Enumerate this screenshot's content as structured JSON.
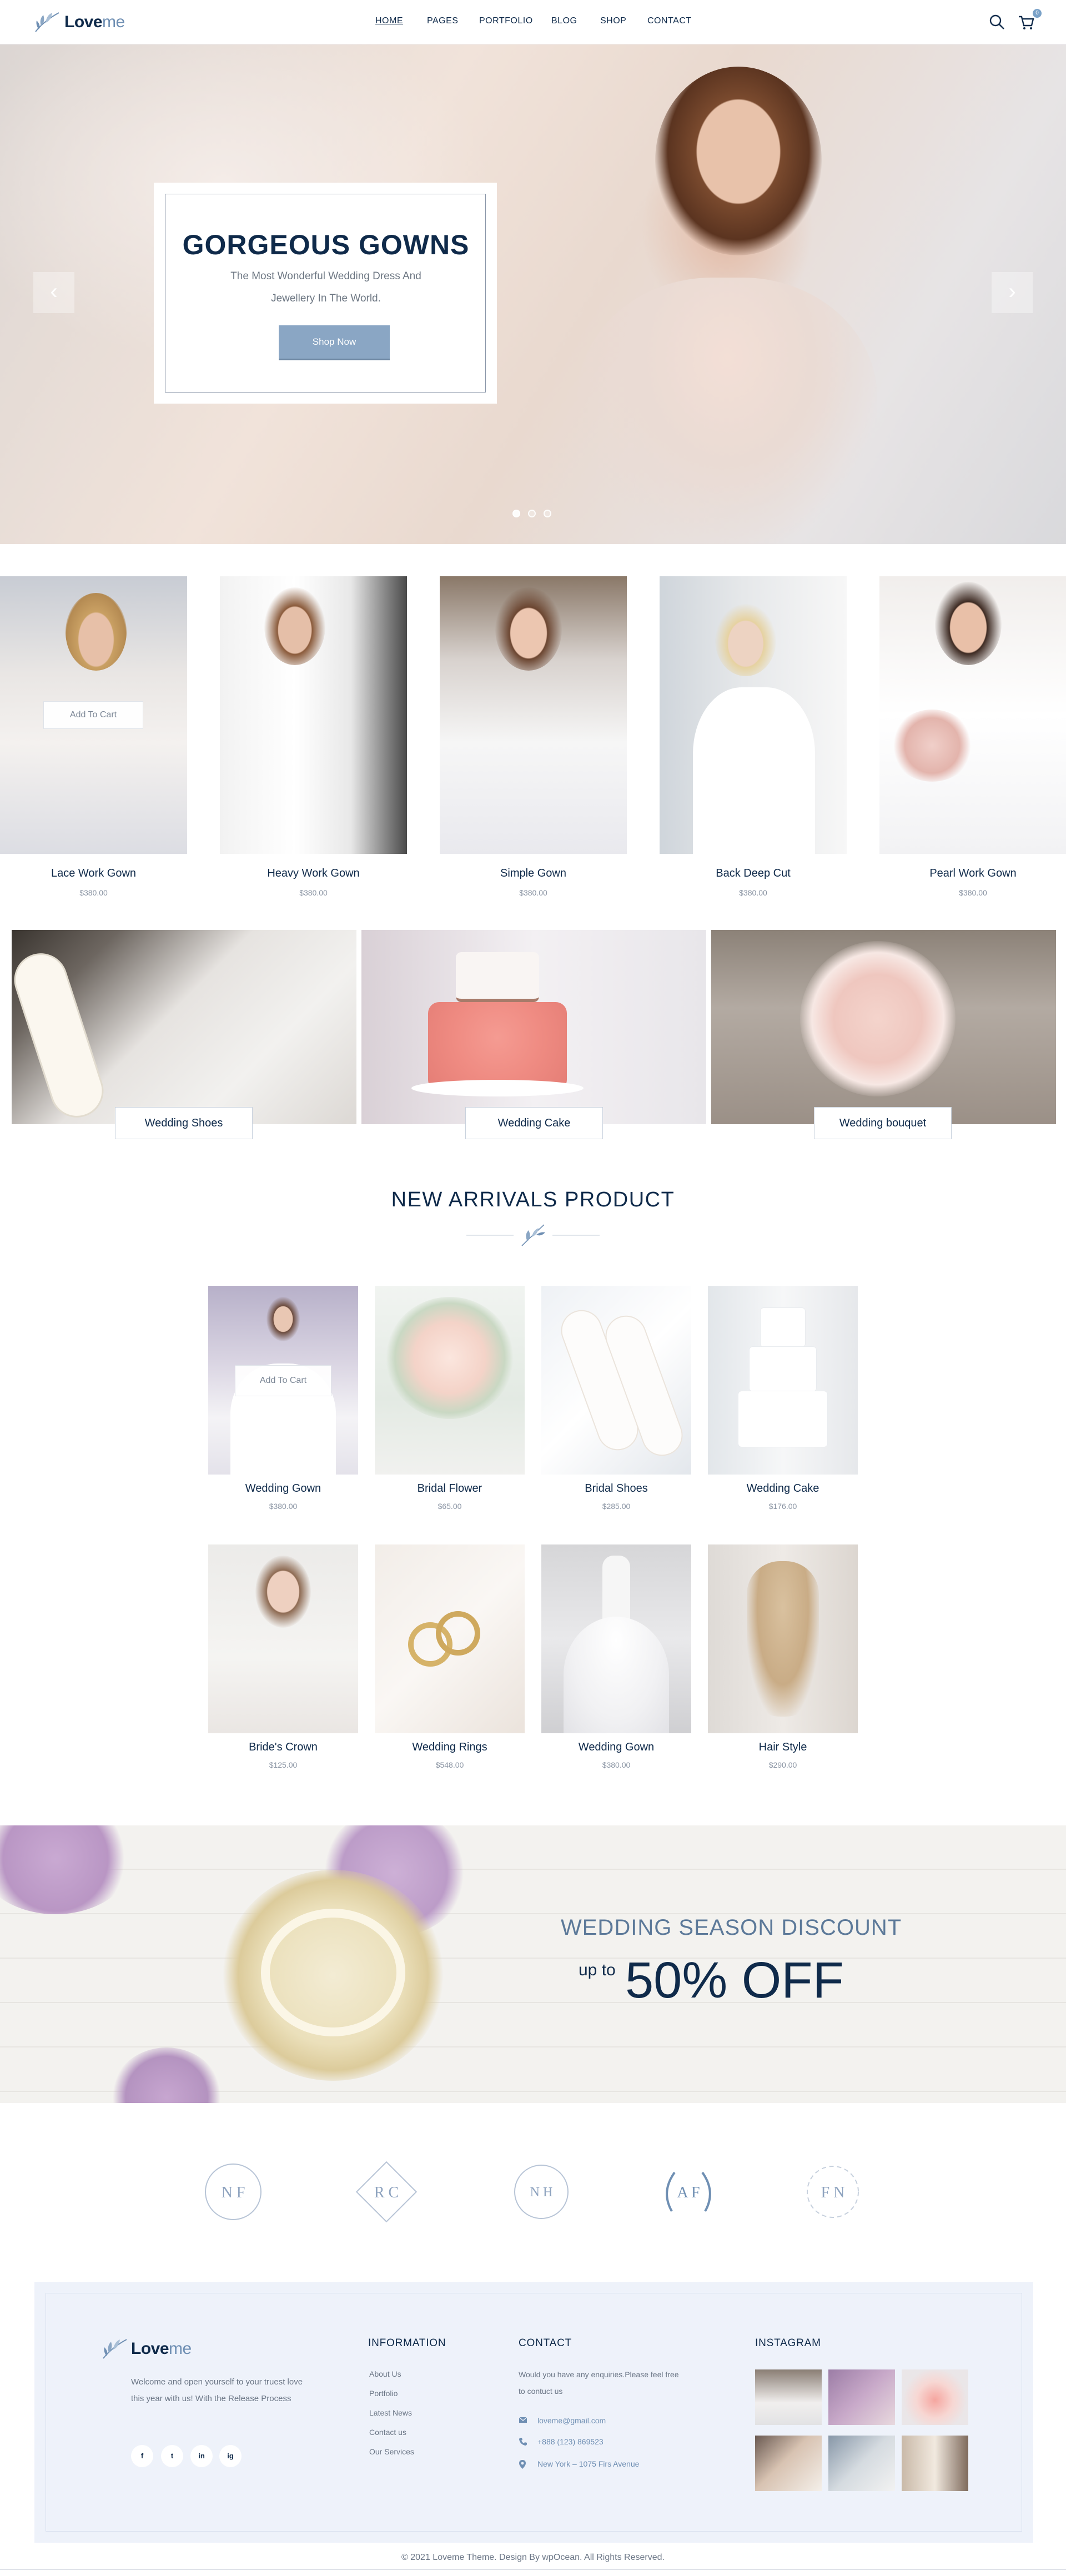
{
  "header": {
    "logo_main": "Love",
    "logo_accent": "me",
    "nav": [
      {
        "label": "HOME",
        "active": true
      },
      {
        "label": "PAGES",
        "active": false
      },
      {
        "label": "PORTFOLIO",
        "active": false
      },
      {
        "label": "BLOG",
        "active": false
      },
      {
        "label": "SHOP",
        "active": false
      },
      {
        "label": "CONTACT",
        "active": false
      }
    ],
    "cart_count": "0",
    "icons": [
      "search-icon",
      "cart-icon"
    ]
  },
  "hero": {
    "title": "GORGEOUS GOWNS",
    "subtitle": "The Most Wonderful Wedding Dress And Jewellery In The World.",
    "button": "Shop Now",
    "prev_glyph": "‹",
    "next_glyph": "›",
    "slides": 3,
    "active_slide": 1
  },
  "featured": {
    "add_to_cart": "Add To Cart",
    "products": [
      {
        "name": "Lace Work Gown",
        "price": "$380.00"
      },
      {
        "name": "Heavy Work Gown",
        "price": "$380.00"
      },
      {
        "name": "Simple Gown",
        "price": "$380.00"
      },
      {
        "name": "Back Deep Cut",
        "price": "$380.00"
      },
      {
        "name": "Pearl Work Gown",
        "price": "$380.00"
      }
    ]
  },
  "categories": [
    {
      "label": "Wedding Shoes"
    },
    {
      "label": "Wedding Cake"
    },
    {
      "label": "Wedding bouquet"
    }
  ],
  "new_arrivals": {
    "title": "NEW ARRIVALS PRODUCT",
    "add_to_cart": "Add To Cart",
    "products": [
      {
        "name": "Wedding Gown",
        "price": "$380.00"
      },
      {
        "name": "Bridal Flower",
        "price": "$65.00"
      },
      {
        "name": "Bridal Shoes",
        "price": "$285.00"
      },
      {
        "name": "Wedding Cake",
        "price": "$176.00"
      },
      {
        "name": "Bride's Crown",
        "price": "$125.00"
      },
      {
        "name": "Wedding Rings",
        "price": "$548.00"
      },
      {
        "name": "Wedding Gown",
        "price": "$380.00"
      },
      {
        "name": "Hair Style",
        "price": "$290.00"
      }
    ]
  },
  "promo": {
    "title": "WEDDING SEASON DISCOUNT",
    "up_to": "up to",
    "offer": "50% OFF"
  },
  "brands": [
    {
      "initials": "N F"
    },
    {
      "initials": "R C"
    },
    {
      "initials": "N H"
    },
    {
      "initials": "A F"
    },
    {
      "initials": "F N"
    }
  ],
  "footer": {
    "logo_main": "Love",
    "logo_accent": "me",
    "about": "Welcome and open yourself to your truest love this year with us! With the Release Process",
    "social": [
      "f",
      "t",
      "in",
      "ig"
    ],
    "information": {
      "heading": "INFORMATION",
      "links": [
        "About Us",
        "Portfolio",
        "Latest News",
        "Contact us",
        "Our Services"
      ]
    },
    "contact": {
      "heading": "CONTACT",
      "text": "Would you have any enquiries.Please feel free to contuct us",
      "email": "loveme@gmail.com",
      "phone": "+888 (123) 869523",
      "address": "New York – 1075 Firs Avenue"
    },
    "instagram": {
      "heading": "INSTAGRAM"
    },
    "copyright": "© 2021 Loveme Theme. Design By wpOcean. All Rights Reserved."
  },
  "colors": {
    "navy": "#0f2a4a",
    "accent": "#8aa6c4",
    "muted": "#6b7686",
    "footer_bg": "#eef2fa"
  }
}
